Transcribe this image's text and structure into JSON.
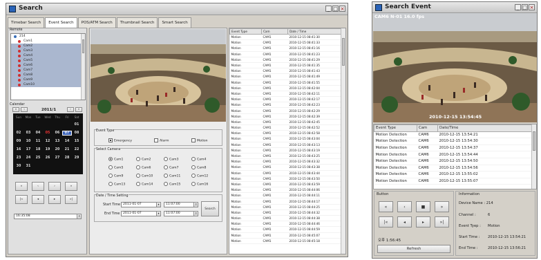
{
  "left_window": {
    "title": "Search",
    "tabs": [
      "Timebar Search",
      "Event Search",
      "POS/ATM Search",
      "Thumbnail Search",
      "Smart Search"
    ],
    "remote_label": "Remote",
    "root_node": "214",
    "cameras": [
      "Cam1",
      "Cam2",
      "Cam3",
      "Cam4",
      "Cam5",
      "Cam6",
      "Cam7",
      "Cam8",
      "Cam9",
      "Cam10"
    ],
    "calendar": {
      "label": "Calendar",
      "month": "2011/1",
      "weekdays": [
        "Sun",
        "Mon",
        "Tue",
        "Wed",
        "Thu",
        "Fri",
        "Sat"
      ],
      "weeks": [
        [
          "",
          "",
          "",
          "",
          "",
          "",
          "01"
        ],
        [
          "02",
          "03",
          "04",
          "05",
          "06",
          "07",
          "08"
        ],
        [
          "09",
          "10",
          "11",
          "12",
          "13",
          "14",
          "15"
        ],
        [
          "16",
          "17",
          "18",
          "19",
          "20",
          "21",
          "22"
        ],
        [
          "23",
          "24",
          "25",
          "26",
          "27",
          "28",
          "29"
        ],
        [
          "30",
          "31",
          "",
          "",
          "",
          "",
          ""
        ]
      ],
      "selected_day": "07"
    },
    "transport_buttons": [
      "«",
      "‹",
      "›",
      "»",
      "|«",
      "◂",
      "▸",
      "»|"
    ],
    "time_value": "16:35:08",
    "event_type": {
      "label": "Event Type",
      "options": [
        {
          "label": "Emergency",
          "checked": true
        },
        {
          "label": "Alarm",
          "checked": false
        },
        {
          "label": "Motion",
          "checked": false
        }
      ]
    },
    "select_camera": {
      "label": "Select Camera",
      "cams": [
        "Cam1",
        "Cam2",
        "Cam3",
        "Cam4",
        "Cam5",
        "Cam6",
        "Cam7",
        "Cam8",
        "Cam9",
        "Cam10",
        "Cam11",
        "Cam12",
        "Cam13",
        "Cam14",
        "Cam15",
        "Cam16"
      ],
      "selected": "Cam1"
    },
    "datetime": {
      "label": "Date / Time Setting",
      "start_label": "Start Time",
      "end_label": "End Time",
      "start_date": "2011-01-07",
      "end_date": "2011-01-07",
      "start_time": "11:07:00",
      "end_time": "11:07:00",
      "search_button": "Search"
    },
    "table": {
      "headers": [
        "Event Type",
        "Cam",
        "Date / Time"
      ],
      "rows": [
        [
          "Motion",
          "CAM1",
          "2010-12-15 08:41:30"
        ],
        [
          "Motion",
          "CAM1",
          "2010-12-15 08:41:33"
        ],
        [
          "Motion",
          "CAM1",
          "2010-12-15 08:41:16"
        ],
        [
          "Motion",
          "CAM1",
          "2010-12-15 08:41:23"
        ],
        [
          "Motion",
          "CAM1",
          "2010-12-15 08:41:29"
        ],
        [
          "Motion",
          "CAM1",
          "2010-12-15 08:41:35"
        ],
        [
          "Motion",
          "CAM1",
          "2010-12-15 08:41:43"
        ],
        [
          "Motion",
          "CAM1",
          "2010-12-15 08:41:49"
        ],
        [
          "Motion",
          "CAM1",
          "2010-12-15 08:41:55"
        ],
        [
          "Motion",
          "CAM1",
          "2010-12-15 08:42:04"
        ],
        [
          "Motion",
          "CAM1",
          "2010-12-15 08:42:11"
        ],
        [
          "Motion",
          "CAM1",
          "2010-12-15 08:42:17"
        ],
        [
          "Motion",
          "CAM1",
          "2010-12-15 08:42:23"
        ],
        [
          "Motion",
          "CAM1",
          "2010-12-15 08:42:29"
        ],
        [
          "Motion",
          "CAM1",
          "2010-12-15 08:42:39"
        ],
        [
          "Motion",
          "CAM1",
          "2010-12-15 08:42:45"
        ],
        [
          "Motion",
          "CAM1",
          "2010-12-15 08:42:52"
        ],
        [
          "Motion",
          "CAM1",
          "2010-12-15 08:42:58"
        ],
        [
          "Motion",
          "CAM1",
          "2010-12-15 08:43:04"
        ],
        [
          "Motion",
          "CAM1",
          "2010-12-15 08:43:13"
        ],
        [
          "Motion",
          "CAM1",
          "2010-12-15 08:43:19"
        ],
        [
          "Motion",
          "CAM1",
          "2010-12-15 08:43:25"
        ],
        [
          "Motion",
          "CAM1",
          "2010-12-15 08:43:32"
        ],
        [
          "Motion",
          "CAM1",
          "2010-12-15 08:43:38"
        ],
        [
          "Motion",
          "CAM1",
          "2010-12-15 08:43:44"
        ],
        [
          "Motion",
          "CAM1",
          "2010-12-15 08:43:50"
        ],
        [
          "Motion",
          "CAM1",
          "2010-12-15 08:43:59"
        ],
        [
          "Motion",
          "CAM1",
          "2010-12-15 08:44:06"
        ],
        [
          "Motion",
          "CAM1",
          "2010-12-15 08:44:11"
        ],
        [
          "Motion",
          "CAM1",
          "2010-12-15 08:44:17"
        ],
        [
          "Motion",
          "CAM1",
          "2010-12-15 08:44:25"
        ],
        [
          "Motion",
          "CAM1",
          "2010-12-15 08:44:32"
        ],
        [
          "Motion",
          "CAM1",
          "2010-12-15 08:44:38"
        ],
        [
          "Motion",
          "CAM1",
          "2010-12-15 08:44:46"
        ],
        [
          "Motion",
          "CAM1",
          "2010-12-15 08:44:59"
        ],
        [
          "Motion",
          "CAM1",
          "2010-12-15 08:45:07"
        ],
        [
          "Motion",
          "CAM1",
          "2010-12-15 08:45:18"
        ]
      ]
    }
  },
  "right_window": {
    "title": "Search Event",
    "osd_top": "CAM6 N-01 16.0 fps",
    "osd_time": "2010-12-15 13:54:45",
    "table": {
      "headers": [
        "Event Type",
        "Cam",
        "Date/Time"
      ],
      "rows": [
        [
          "Motion Detection",
          "CAM6",
          "2010-12-15 13:54:21"
        ],
        [
          "Motion Detection",
          "CAM6",
          "2010-12-15 13:54:30"
        ],
        [
          "Motion Detection",
          "CAM6",
          "2010-12-15 13:54:37"
        ],
        [
          "Motion Detection",
          "CAM6",
          "2010-12-15 13:54:44"
        ],
        [
          "Motion Detection",
          "CAM6",
          "2010-12-15 13:54:50"
        ],
        [
          "Motion Detection",
          "CAM6",
          "2010-12-15 13:54:56"
        ],
        [
          "Motion Detection",
          "CAM6",
          "2010-12-15 13:55:02"
        ],
        [
          "Motion Detection",
          "CAM6",
          "2010-12-15 13:55:07"
        ]
      ]
    },
    "button_group": "Button",
    "controls": [
      "«",
      "‹",
      "■",
      "»",
      "|«",
      "◂",
      "▸",
      "»|"
    ],
    "time_label": "오후 1:56:45",
    "refresh": "Refresh",
    "info": {
      "group": "Information",
      "device": "Device Name : 214",
      "channel_label": "Channel :",
      "channel": "6",
      "event_label": "Event Tyep :",
      "event": "Motion",
      "start_label": "Start Time :",
      "start": "2010-12-15 13:54:21",
      "end_label": "End Time :",
      "end": "2010-12-15 13:56:21"
    }
  }
}
